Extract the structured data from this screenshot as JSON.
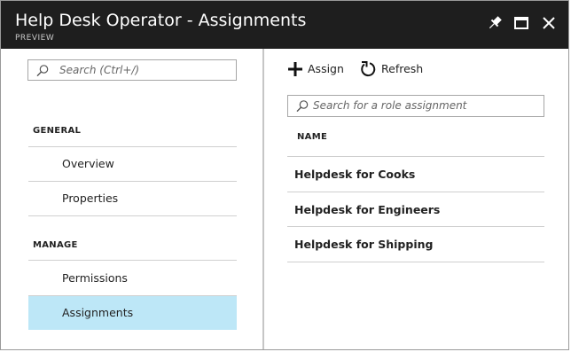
{
  "window": {
    "title": "Help Desk Operator - Assignments",
    "subtitle": "PREVIEW",
    "controls": [
      "pin-icon",
      "maximize-icon",
      "close-icon"
    ]
  },
  "left_pane": {
    "search": {
      "placeholder": "Search (Ctrl+/)"
    },
    "sections": [
      {
        "label": "GENERAL",
        "items": [
          {
            "label": "Overview"
          },
          {
            "label": "Properties"
          }
        ]
      },
      {
        "label": "MANAGE",
        "items": [
          {
            "label": "Permissions"
          },
          {
            "label": "Assignments",
            "selected": true
          }
        ]
      }
    ]
  },
  "toolbar": {
    "assign_label": "Assign",
    "refresh_label": "Refresh"
  },
  "right_pane": {
    "search": {
      "placeholder": "Search for a role assignment"
    },
    "table": {
      "columns": [
        "NAME"
      ],
      "rows": [
        {
          "name": "Helpdesk for Cooks"
        },
        {
          "name": "Helpdesk for Engineers"
        },
        {
          "name": "Helpdesk for Shipping"
        }
      ]
    }
  },
  "colors": {
    "header_bg": "#1e1e1e",
    "selected_item_bg": "#bde7f7",
    "divider": "#c6c6c6"
  }
}
